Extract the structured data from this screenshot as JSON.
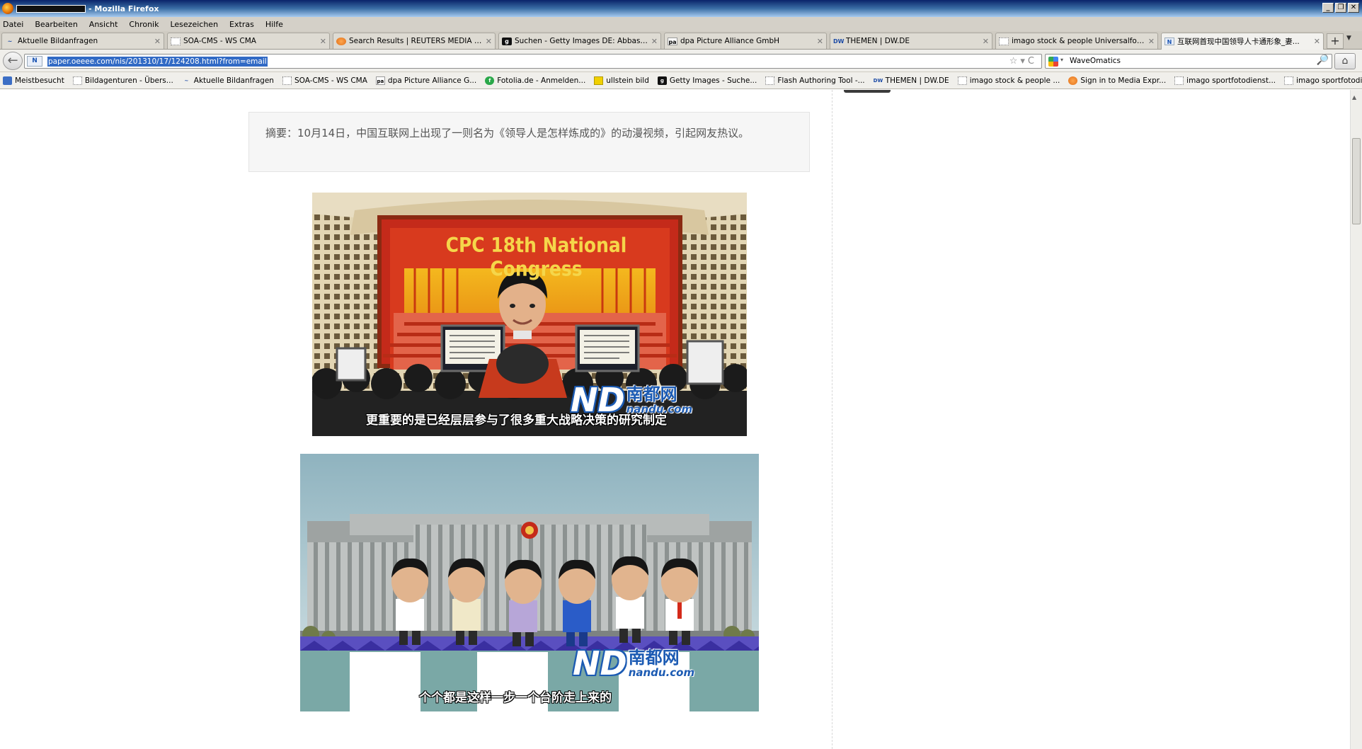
{
  "window": {
    "title": "- Mozilla Firefox",
    "controls": [
      "_",
      "❐",
      "✕"
    ]
  },
  "menu": [
    "Datei",
    "Bearbeiten",
    "Ansicht",
    "Chronik",
    "Lesezeichen",
    "Extras",
    "Hilfe"
  ],
  "tabs": [
    {
      "label": "Aktuelle Bildanfragen",
      "icon": "ico-blue",
      "glyph": "~"
    },
    {
      "label": "SOA-CMS - WS CMA",
      "icon": "ico-page",
      "glyph": ""
    },
    {
      "label": "Search Results | REUTERS MEDIA EXP...",
      "icon": "ico-reuters",
      "glyph": ""
    },
    {
      "label": "Suchen - Getty Images DE: Abbas + ...",
      "icon": "ico-g",
      "glyph": "g"
    },
    {
      "label": "dpa Picture Alliance GmbH",
      "icon": "ico-pa",
      "glyph": "pa"
    },
    {
      "label": "THEMEN | DW.DE",
      "icon": "ico-dw",
      "glyph": "DW"
    },
    {
      "label": "imago stock & people Universalfotoar...",
      "icon": "ico-page",
      "glyph": ""
    },
    {
      "label": "互联网首现中国领导人卡通形象_妻...",
      "icon": "ico-nd",
      "glyph": "N"
    }
  ],
  "tab_close_glyph": "✕",
  "newtab_glyph": "+",
  "tabmenu_glyph": "▼",
  "nav": {
    "back_glyph": "←",
    "url": "paper.oeeee.com/nis/201310/17/124208.html?from=email",
    "site_icon": "N",
    "url_right_icons": "☆▾C",
    "search_engine_arrow": "▾",
    "search_value": "WaveOmatics",
    "search_glyph": "🔎",
    "home_glyph": "⌂"
  },
  "bookmarks": [
    {
      "label": "Meistbesucht",
      "icon": "ico-folder",
      "glyph": ""
    },
    {
      "label": "Bildagenturen - Übers...",
      "icon": "ico-page",
      "glyph": ""
    },
    {
      "label": "Aktuelle Bildanfragen",
      "icon": "ico-blue",
      "glyph": "~"
    },
    {
      "label": "SOA-CMS - WS CMA",
      "icon": "ico-page",
      "glyph": ""
    },
    {
      "label": "dpa Picture Alliance G...",
      "icon": "ico-pa",
      "glyph": "pa"
    },
    {
      "label": "Fotolia.de - Anmelden...",
      "icon": "ico-fotolia",
      "glyph": "f"
    },
    {
      "label": "ullstein bild",
      "icon": "ico-ullstein",
      "glyph": ""
    },
    {
      "label": "Getty Images - Suche...",
      "icon": "ico-g",
      "glyph": "g"
    },
    {
      "label": "Flash Authoring Tool -...",
      "icon": "ico-page",
      "glyph": ""
    },
    {
      "label": "THEMEN | DW.DE",
      "icon": "ico-dw",
      "glyph": "DW"
    },
    {
      "label": "imago stock & people ...",
      "icon": "ico-page",
      "glyph": ""
    },
    {
      "label": "Sign in to Media Expr...",
      "icon": "ico-reuters",
      "glyph": ""
    },
    {
      "label": "imago sportfotodienst...",
      "icon": "ico-page",
      "glyph": ""
    },
    {
      "label": "imago sportfotodienst...",
      "icon": "ico-page",
      "glyph": ""
    }
  ],
  "article": {
    "summary": "摘要：10月14日，中国互联网上出现了一则名为《领导人是怎样炼成的》的动漫视频，引起网友热议。",
    "image1": {
      "banner": "CPC 18th National Congress",
      "subtitle": "更重要的是已经层层参与了很多重大战略决策的研究制定",
      "watermark_cn": "南都网",
      "watermark_en": "nandu.com",
      "watermark_mark": "ND"
    },
    "image2": {
      "subtitle": "个个都是这样一步一个台阶走上来的",
      "watermark_cn": "南都网",
      "watermark_en": "nandu.com",
      "watermark_mark": "ND"
    }
  },
  "colors": {
    "titlebar": "#0a246a",
    "url_highlight": "#316ac5",
    "nandu_blue": "#1c5bb3",
    "banner_red": "#d4281c",
    "banner_text": "#f5d64a"
  }
}
